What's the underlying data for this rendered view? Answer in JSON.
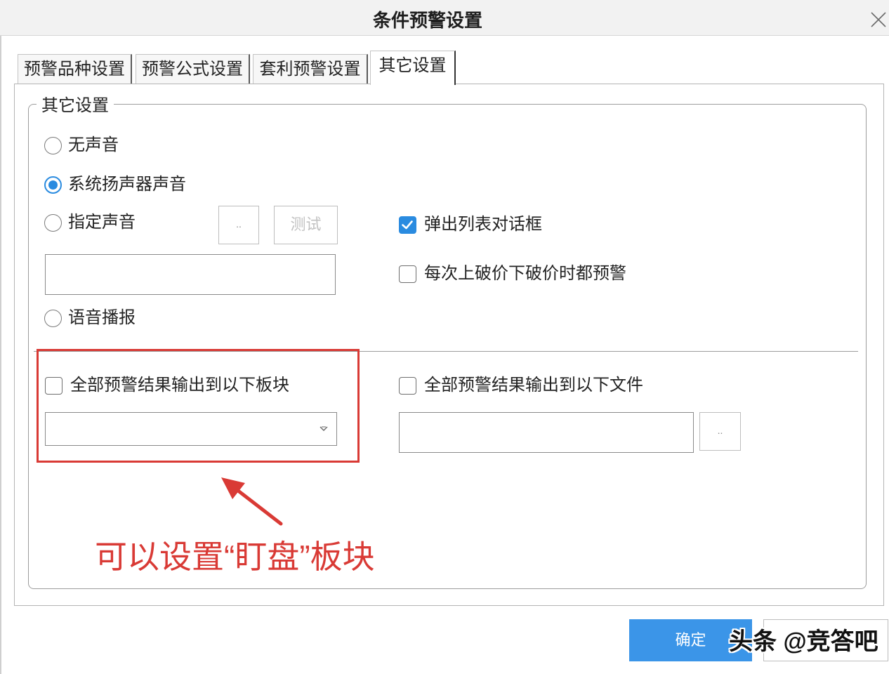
{
  "dialog": {
    "title": "条件预警设置",
    "close_icon": "close-icon"
  },
  "tabs": [
    {
      "label": "预警品种设置",
      "active": false
    },
    {
      "label": "预警公式设置",
      "active": false
    },
    {
      "label": "套利预警设置",
      "active": false
    },
    {
      "label": "其它设置",
      "active": true
    }
  ],
  "group": {
    "legend": "其它设置"
  },
  "sound": {
    "options": [
      {
        "label": "无声音",
        "checked": false
      },
      {
        "label": "系统扬声器声音",
        "checked": true
      },
      {
        "label": "指定声音",
        "checked": false
      },
      {
        "label": "语音播报",
        "checked": false
      }
    ],
    "browse_label": "..",
    "test_label": "测试",
    "file_value": ""
  },
  "popup": {
    "label": "弹出列表对话框",
    "checked": true
  },
  "each_break": {
    "label": "每次上破价下破价时都预警",
    "checked": false
  },
  "output_block": {
    "label": "全部预警结果输出到以下板块",
    "checked": false,
    "selected": "",
    "dropdown_icon": "chevron-down-icon"
  },
  "output_file": {
    "label": "全部预警结果输出到以下文件",
    "checked": false,
    "value": "",
    "browse_label": ".."
  },
  "annotation": {
    "text": "可以设置“盯盘”板块",
    "arrow_icon": "arrow-icon"
  },
  "footer": {
    "ok_label": "确定"
  },
  "watermark": "头条 @竞答吧",
  "colors": {
    "accent": "#2a8be0",
    "annotation": "#d93a35",
    "ok_button": "#3b95e8"
  }
}
